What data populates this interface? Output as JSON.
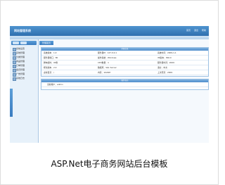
{
  "caption": "ASP.Net电子商务网站后台模板",
  "header": {
    "logo": "网站管理系统",
    "links": [
      "首页",
      "退出",
      "帮助"
    ]
  },
  "sidebar": {
    "items": [
      "系统设置",
      "系统管理",
      "分类管理",
      "商品管理",
      "订单管理",
      "会员管理",
      "广告管理",
      "系统日志"
    ]
  },
  "main": {
    "crumb": "管理首页",
    "panel1": {
      "title": "系统信息",
      "rows": [
        [
          "系统版本：1.0",
          "服务器IP：127.0.0.1",
          "系统时间：2009-1-1"
        ],
        [
          "服务器端口：80",
          "操作系统：Windows",
          "IIS版本：IIS6.0"
        ],
        [
          "脚本超时：90秒",
          "CPU数量：1",
          "服务器时间：2009"
        ],
        [
          "框架版本：2.0",
          "数据库：SQL Server",
          "语言：中文"
        ],
        [
          "虚拟目录：/",
          "内存：1024M",
          "上次登录：2009"
        ]
      ]
    },
    "panel2": {
      "title": "操作日志",
      "rows": [
        [
          "当前用户：admin"
        ]
      ]
    }
  }
}
